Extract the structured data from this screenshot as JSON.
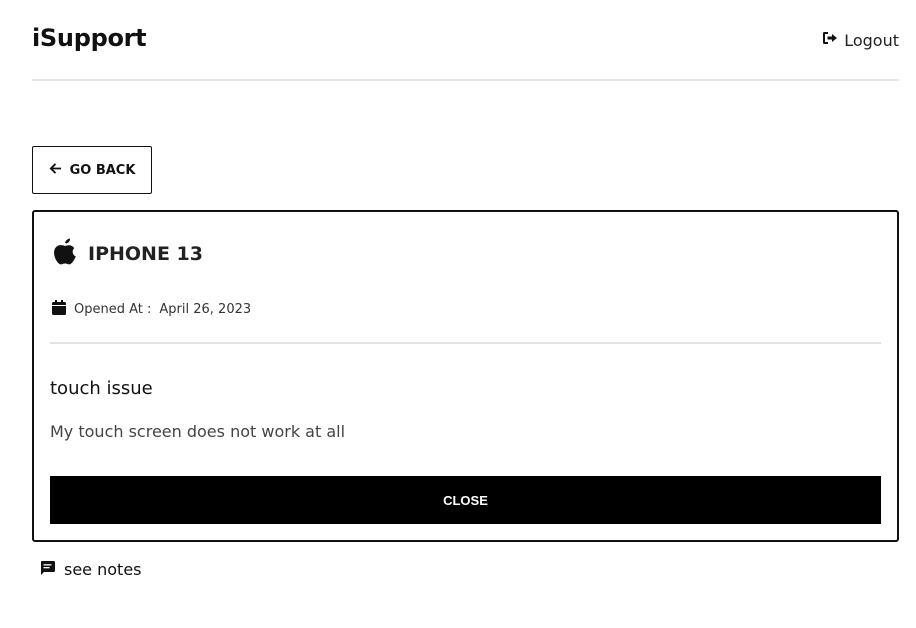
{
  "header": {
    "brand": "iSupport",
    "logout_label": "Logout"
  },
  "nav": {
    "back_label": "GO BACK"
  },
  "ticket": {
    "product": "IPHONE 13",
    "opened_label": "Opened At :",
    "opened_date": "April 26, 2023",
    "issue_title": "touch issue",
    "issue_description": "My touch screen does not work at all",
    "close_label": "CLOSE"
  },
  "notes": {
    "label": "see notes"
  },
  "icons": {
    "logout": "sign-out-icon",
    "back": "arrow-left-icon",
    "product": "apple-icon",
    "date": "calendar-icon",
    "notes": "comment-icon"
  },
  "colors": {
    "primary": "#000000",
    "text": "#111111",
    "muted": "#444444",
    "divider": "#e3e3e3"
  }
}
